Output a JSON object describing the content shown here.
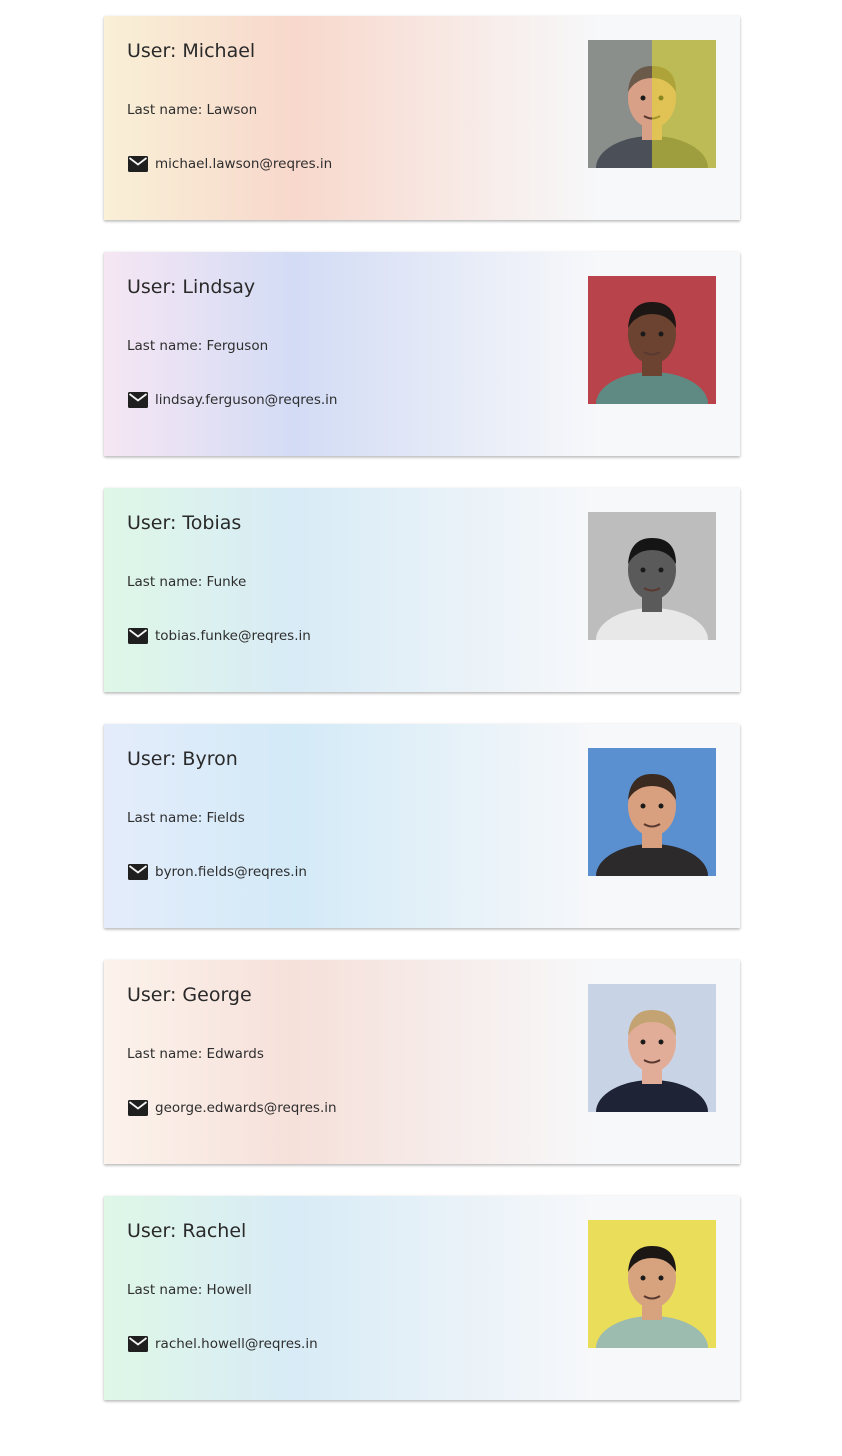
{
  "users": [
    {
      "name_label": "User: Michael",
      "last_label": "Last name: Lawson",
      "email": "michael.lawson@reqres.in",
      "gradient": [
        "#f9f0d6",
        "#f8d8cc",
        "#f7f8fa"
      ],
      "avatar_colors": {
        "bg": "#8a8f8c",
        "skin": "#d9a088",
        "hair": "#6b5a4a",
        "shirt": "#4a4f58",
        "tint": "#e6e02a"
      }
    },
    {
      "name_label": "User: Lindsay",
      "last_label": "Last name: Ferguson",
      "email": "lindsay.ferguson@reqres.in",
      "gradient": [
        "#f6e6f3",
        "#d3dcf5",
        "#f7f8fa"
      ],
      "avatar_colors": {
        "bg": "#b8434a",
        "skin": "#6b4330",
        "hair": "#1c1614",
        "shirt": "#5f8a84",
        "tint": ""
      }
    },
    {
      "name_label": "User: Tobias",
      "last_label": "Last name: Funke",
      "email": "tobias.funke@reqres.in",
      "gradient": [
        "#dff7e7",
        "#d8ebf6",
        "#f7f8fa"
      ],
      "avatar_colors": {
        "bg": "#bdbdbd",
        "skin": "#5a5a5a",
        "hair": "#151515",
        "shirt": "#e8e8e8",
        "tint": ""
      }
    },
    {
      "name_label": "User: Byron",
      "last_label": "Last name: Fields",
      "email": "byron.fields@reqres.in",
      "gradient": [
        "#e4ecfb",
        "#d3eaf7",
        "#f7f8fa"
      ],
      "avatar_colors": {
        "bg": "#5a8fd0",
        "skin": "#d8a07f",
        "hair": "#3a2a20",
        "shirt": "#2c2a2a",
        "tint": ""
      }
    },
    {
      "name_label": "User: George",
      "last_label": "Last name: Edwards",
      "email": "george.edwards@reqres.in",
      "gradient": [
        "#fcf3ec",
        "#f6e0da",
        "#f7f8fa"
      ],
      "avatar_colors": {
        "bg": "#c9d3e6",
        "skin": "#e2ad98",
        "hair": "#c4a373",
        "shirt": "#1e2336",
        "tint": ""
      }
    },
    {
      "name_label": "User: Rachel",
      "last_label": "Last name: Howell",
      "email": "rachel.howell@reqres.in",
      "gradient": [
        "#dff7e7",
        "#d8ebf6",
        "#f7f8fa"
      ],
      "avatar_colors": {
        "bg": "#eadd5a",
        "skin": "#d7a37f",
        "hair": "#1b1715",
        "shirt": "#9cbcb0",
        "tint": ""
      }
    }
  ],
  "icons": {
    "email": "mail-icon"
  }
}
